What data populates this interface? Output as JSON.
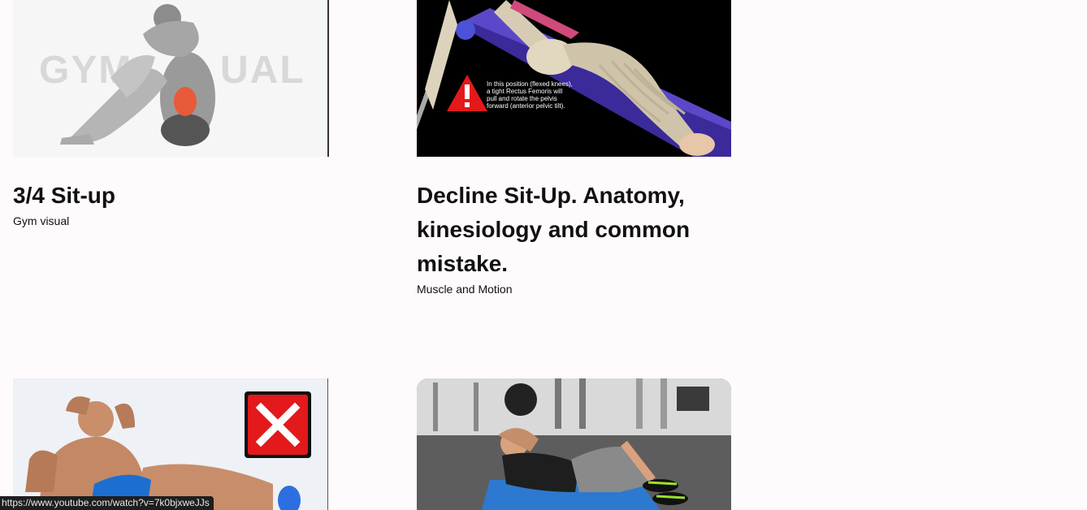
{
  "cards": [
    {
      "title": "3/4 Sit-up",
      "channel": "Gym visual",
      "thumbnail_icon": "sit-up-figure-icon",
      "watermark": "GYMVISUAL"
    },
    {
      "title": "Decline Sit-Up. Anatomy, kinesiology and common mistake.",
      "channel": "Muscle and Motion",
      "thumbnail_icon": "skeleton-anatomy-icon",
      "thumbnail_caption_lines": [
        "In this position (flexed knees),",
        "a tight Rectus Femoris will",
        "pull and rotate the pelvis",
        "forward (anterior pelvic tilt)."
      ]
    },
    {
      "title": "",
      "channel": "",
      "thumbnail_icon": "man-situp-with-x-icon"
    },
    {
      "title": "",
      "channel": "",
      "thumbnail_icon": "gym-crunch-photo-icon"
    }
  ],
  "status_bar": {
    "url": "https://www.youtube.com/watch?v=7k0bjxweJJs"
  },
  "colors": {
    "background": "#fffafb",
    "text": "#111111",
    "warning_red": "#e3191b",
    "status_bar_bg": "#1e1e1e"
  }
}
